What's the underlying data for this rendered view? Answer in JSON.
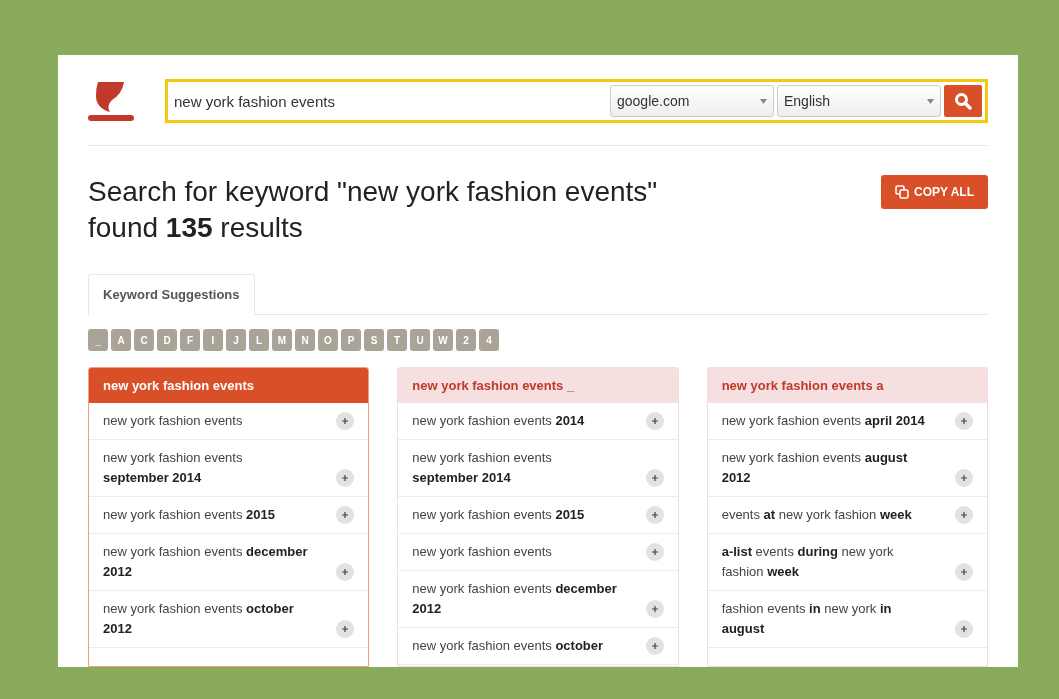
{
  "search": {
    "query": "new york fashion events",
    "engine": "google.com",
    "language": "English"
  },
  "heading": "Search for keyword \"new york fashion events\" found **135** results",
  "copy_button": "COPY ALL",
  "tabs": [
    {
      "label": "Keyword Suggestions",
      "selected": true
    }
  ],
  "letters": [
    "_",
    "A",
    "C",
    "D",
    "F",
    "I",
    "J",
    "L",
    "M",
    "N",
    "O",
    "P",
    "S",
    "T",
    "U",
    "W",
    "2",
    "4"
  ],
  "columns": [
    {
      "title": "new york fashion events",
      "selected": true,
      "items": [
        "new york fashion events",
        "new york fashion events **september 2014**",
        "new york fashion events **2015**",
        "new york fashion events **december 2012**",
        "new york fashion events **october 2012**"
      ]
    },
    {
      "title": "new york fashion events _",
      "selected": false,
      "items": [
        "new york fashion events **2014**",
        "new york fashion events **september 2014**",
        "new york fashion events **2015**",
        "new york fashion events",
        "new york fashion events **december 2012**",
        "new york fashion events **october**"
      ]
    },
    {
      "title": "new york fashion events a",
      "selected": false,
      "items": [
        "new york fashion events **april 2014**",
        "new york fashion events **august 2012**",
        "events **at** new york fashion **week**",
        "**a-list** events **during** new york fashion **week**",
        "fashion events **in** new york **in august**"
      ]
    }
  ]
}
